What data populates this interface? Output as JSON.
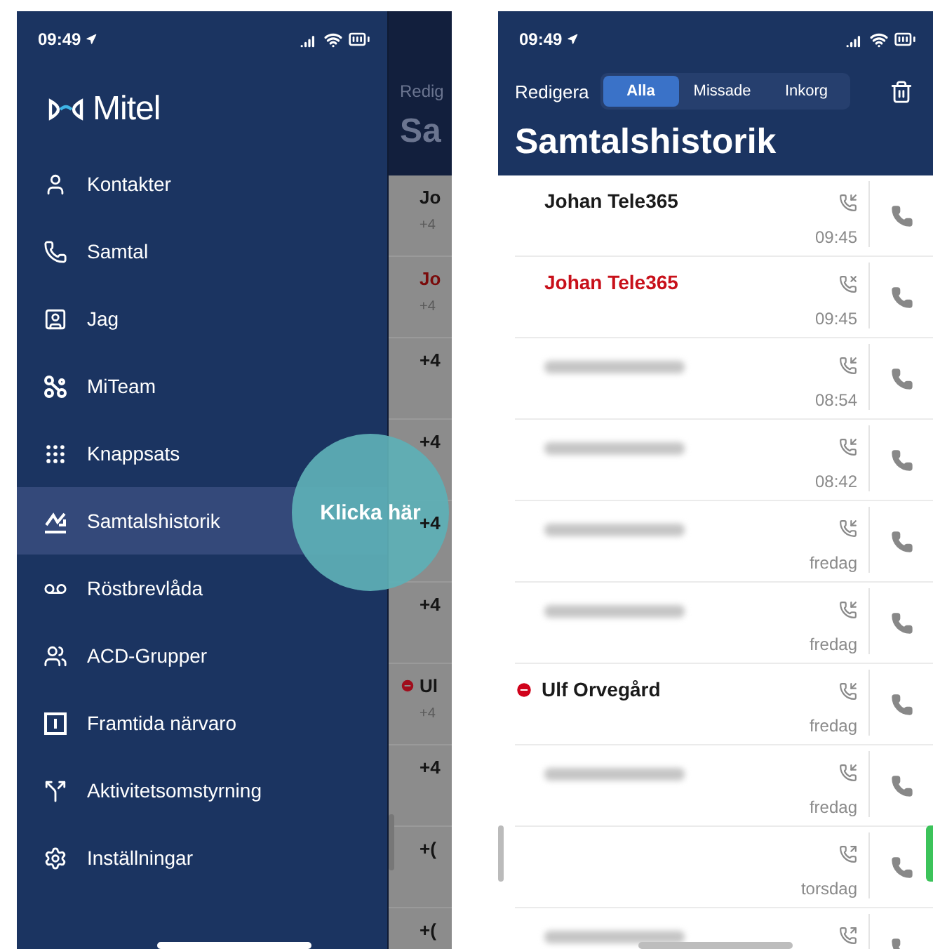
{
  "left_phone": {
    "status_bar": {
      "time": "09:49"
    },
    "logo": {
      "wordmark": "Mitel"
    },
    "menu": [
      {
        "label": "Kontakter",
        "selected": false
      },
      {
        "label": "Samtal",
        "selected": false
      },
      {
        "label": "Jag",
        "selected": false
      },
      {
        "label": "MiTeam",
        "selected": false
      },
      {
        "label": "Knappsats",
        "selected": false
      },
      {
        "label": "Samtalshistorik",
        "selected": true
      },
      {
        "label": "Röstbrevlåda",
        "selected": false
      },
      {
        "label": "ACD-Grupper",
        "selected": false
      },
      {
        "label": "Framtida närvaro",
        "selected": false
      },
      {
        "label": "Aktivitetsomstyrning",
        "selected": false
      },
      {
        "label": "Inställningar",
        "selected": false
      }
    ],
    "hint_bubble": {
      "label": "Klicka här"
    },
    "background_app": {
      "edit": "Redig",
      "title": "Sa",
      "rows": [
        {
          "line1": "Jo",
          "line2": "+4",
          "missed": false,
          "dnd": false
        },
        {
          "line1": "Jo",
          "line2": "+4",
          "missed": true,
          "dnd": false
        },
        {
          "line1": "+4",
          "missed": false,
          "dnd": false
        },
        {
          "line1": "+4",
          "missed": false,
          "dnd": false
        },
        {
          "line1": "+4",
          "missed": false,
          "dnd": false
        },
        {
          "line1": "+4",
          "missed": false,
          "dnd": false
        },
        {
          "line1": "Ul",
          "line2": "+4",
          "missed": false,
          "dnd": true
        },
        {
          "line1": "+4",
          "missed": false,
          "dnd": false
        },
        {
          "line1": "+(",
          "missed": false,
          "dnd": false
        },
        {
          "line1": "+(",
          "missed": false,
          "dnd": false
        }
      ]
    }
  },
  "right_phone": {
    "status_bar": {
      "time": "09:49"
    },
    "edit": "Redigera",
    "segments": [
      {
        "label": "Alla",
        "selected": true
      },
      {
        "label": "Missade",
        "selected": false
      },
      {
        "label": "Inkorg",
        "selected": false
      }
    ],
    "title": "Samtalshistorik",
    "calls": [
      {
        "name": "Johan Tele365",
        "caller_hidden": false,
        "missed": false,
        "dnd": false,
        "kind": "incoming",
        "time": "09:45"
      },
      {
        "name": "Johan Tele365",
        "caller_hidden": false,
        "missed": true,
        "dnd": false,
        "kind": "missed",
        "time": "09:45"
      },
      {
        "caller_hidden": true,
        "missed": false,
        "dnd": false,
        "kind": "incoming",
        "time": "08:54"
      },
      {
        "caller_hidden": true,
        "missed": false,
        "dnd": false,
        "kind": "incoming",
        "time": "08:42"
      },
      {
        "caller_hidden": true,
        "missed": false,
        "dnd": false,
        "kind": "incoming",
        "time": "fredag"
      },
      {
        "caller_hidden": true,
        "missed": false,
        "dnd": false,
        "kind": "incoming",
        "time": "fredag"
      },
      {
        "name": "Ulf Orvegård",
        "caller_hidden": false,
        "missed": false,
        "dnd": true,
        "kind": "incoming",
        "time": "fredag"
      },
      {
        "caller_hidden": true,
        "missed": false,
        "dnd": false,
        "kind": "incoming",
        "time": "fredag"
      },
      {
        "caller_hidden": false,
        "dnd": false,
        "kind": "outgoing",
        "time": "torsdag"
      },
      {
        "caller_hidden": true,
        "missed": false,
        "dnd": false,
        "kind": "outgoing"
      }
    ]
  }
}
